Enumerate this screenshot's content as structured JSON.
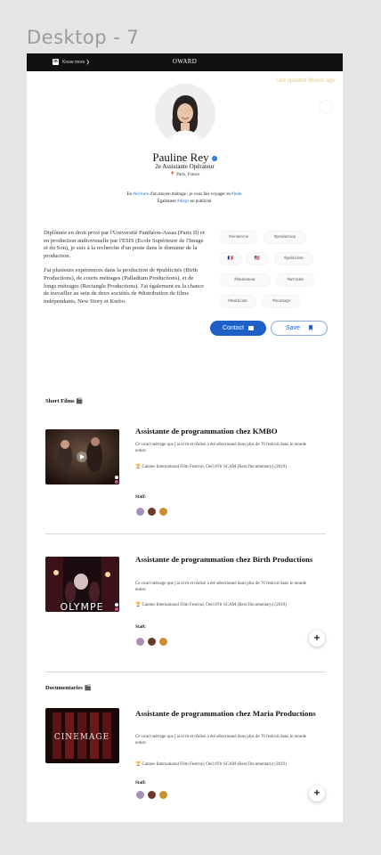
{
  "frame_label": "Desktop - 7",
  "topbar": {
    "linkedin_glyph": "in",
    "know_more": "Know more ❯",
    "logo": "ОWARD"
  },
  "updated": "Last updated 9hours ago",
  "profile": {
    "name": "Pauline Rey",
    "verified_glyph": "✓",
    "role": "2e Assistante Opérateur",
    "location_pin": "📍",
    "location": "Paris, France"
  },
  "tagline": {
    "p1": "En ",
    "h1": "#écriture",
    "p2": " d'un moyen métrage ; je vous fais voyager en ",
    "h2": "#inde",
    "p3": ".",
    "p4": "Également ",
    "h3": "#dispo",
    "p5": " en publicité."
  },
  "bio": {
    "p1": "Diplômée en droit privé par l'Université Panthéon-Assas (Paris II) et en production audiovisuelle par l'ESIS (Ecole Supérieure de l'Image et du Son), je suis à la recherche d'un poste dans le domaine de la production.",
    "p2": "J'ai plusieurs expériences dans la production de #publicités (Birth Productions), de courts métrages (Palladium Productions), et de longs métrages (Rectangle Productions). J'ai également eu la chance de travailler au sein de deux sociétés de #distribution de films indépendants, New Story et Kmbo."
  },
  "tags": [
    "#recherche",
    "#production",
    "🇫🇷",
    "🇺🇸",
    "#publicités",
    "#étalonneur",
    "#artvideo",
    "#multicam",
    "#tournage"
  ],
  "buttons": {
    "contact": "Contact",
    "save": "Save"
  },
  "sections": {
    "short_films": "Short Films 🎬",
    "documentaries": "Documentaries 🎬"
  },
  "cards": [
    {
      "title": "Assistante de programmation chez KMBO",
      "desc": "Ce court métrage que j'ai écrit et réalisé a été sélectionné dans plus de 70 festival dans le monde entier.",
      "award": "🏆 Cannes International Film Festival, Oeil d'Or SCAM (Best Documentary) (2019)",
      "staff_label": "Staff:"
    },
    {
      "title": "Assistante de programmation chez Birth Productions",
      "desc": "Ce court métrage que j'ai écrit et réalisé a été sélectionné dans plus de 70 festival dans le monde entier.",
      "award": "🏆 Cannes International Film Festival, Oeil d'Or SCAM (Best Documentary) (2019)",
      "staff_label": "Staff:",
      "thumb_text": "OLYMPE",
      "plus": "+"
    },
    {
      "title": "Assistante de programmation chez Maria Productions",
      "desc": "Ce court métrage que j'ai écrit et réalisé a été sélectionné dans plus de 70 festival dans le monde entier.",
      "award": "🏆 Cannes International Film Festival, Oeil d'Or SCAM (Best Documentary) (2019)",
      "staff_label": "Staff:",
      "thumb_text": "CINEMAGE",
      "plus": "+"
    }
  ],
  "colors": {
    "accent": "#1e5fc8",
    "topbar": "#111111",
    "hashtag": "#1d6fd6",
    "updated": "#e9c98a"
  }
}
